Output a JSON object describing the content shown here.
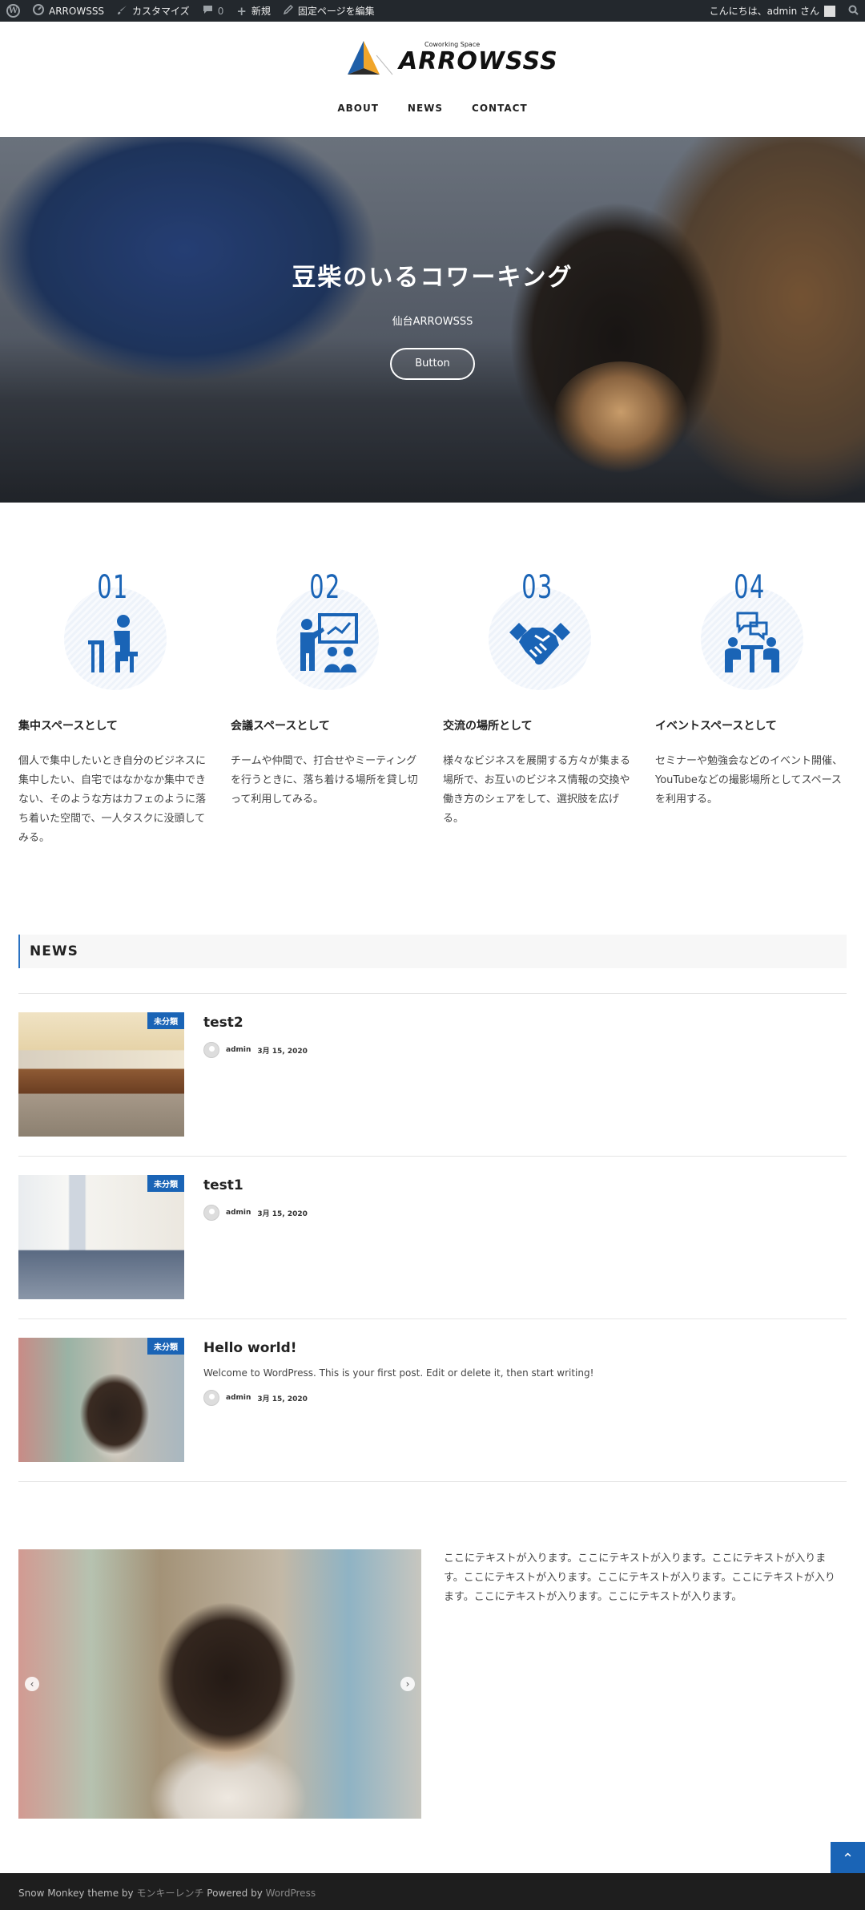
{
  "adminbar": {
    "site_name": "ARROWSSS",
    "customize": "カスタマイズ",
    "comments_count": "0",
    "new": "新規",
    "edit_page": "固定ページを編集",
    "greeting": "こんにちは、admin さん"
  },
  "header": {
    "logo_subtitle": "Coworking Space",
    "logo_name": "ARROWSSS",
    "nav": [
      "ABOUT",
      "NEWS",
      "CONTACT"
    ]
  },
  "hero": {
    "title": "豆柴のいるコワーキング",
    "subtitle": "仙台ARROWSSS",
    "button": "Button"
  },
  "features": [
    {
      "number": "01",
      "icon": "desk-worker-icon",
      "title": "集中スペースとして",
      "text": "個人で集中したいとき自分のビジネスに集中したい、自宅ではなかなか集中できない、そのような方はカフェのように落ち着いた空間で、一人タスクに没頭してみる。"
    },
    {
      "number": "02",
      "icon": "presentation-icon",
      "title": "会議スペースとして",
      "text": "チームや仲間で、打合せやミーティングを行うときに、落ち着ける場所を貸し切って利用してみる。"
    },
    {
      "number": "03",
      "icon": "handshake-icon",
      "title": "交流の場所として",
      "text": "様々なビジネスを展開する方々が集まる場所で、お互いのビジネス情報の交換や働き方のシェアをして、選択肢を広げる。"
    },
    {
      "number": "04",
      "icon": "meeting-chat-icon",
      "title": "イベントスペースとして",
      "text": "セミナーや勉強会などのイベント開催、YouTubeなどの撮影場所としてスペースを利用する。"
    }
  ],
  "news": {
    "heading": "NEWS",
    "posts": [
      {
        "title": "test2",
        "category": "未分類",
        "author": "admin",
        "date": "3月 15, 2020",
        "excerpt": ""
      },
      {
        "title": "test1",
        "category": "未分類",
        "author": "admin",
        "date": "3月 15, 2020",
        "excerpt": ""
      },
      {
        "title": "Hello world!",
        "category": "未分類",
        "author": "admin",
        "date": "3月 15, 2020",
        "excerpt": "Welcome to WordPress. This is your first post. Edit or delete it, then start writing!"
      }
    ]
  },
  "bottom": {
    "text": "ここにテキストが入ります。ここにテキストが入ります。ここにテキストが入ります。ここにテキストが入ります。ここにテキストが入ります。ここにテキストが入ります。ここにテキストが入ります。ここにテキストが入ります。"
  },
  "footer": {
    "prefix": "Snow Monkey theme by ",
    "author_link": "モンキーレンチ",
    "powered": " Powered by ",
    "wp_link": "WordPress"
  },
  "colors": {
    "accent": "#1a64b6",
    "adminbar": "#23282d",
    "footer": "#1e1e1e"
  }
}
